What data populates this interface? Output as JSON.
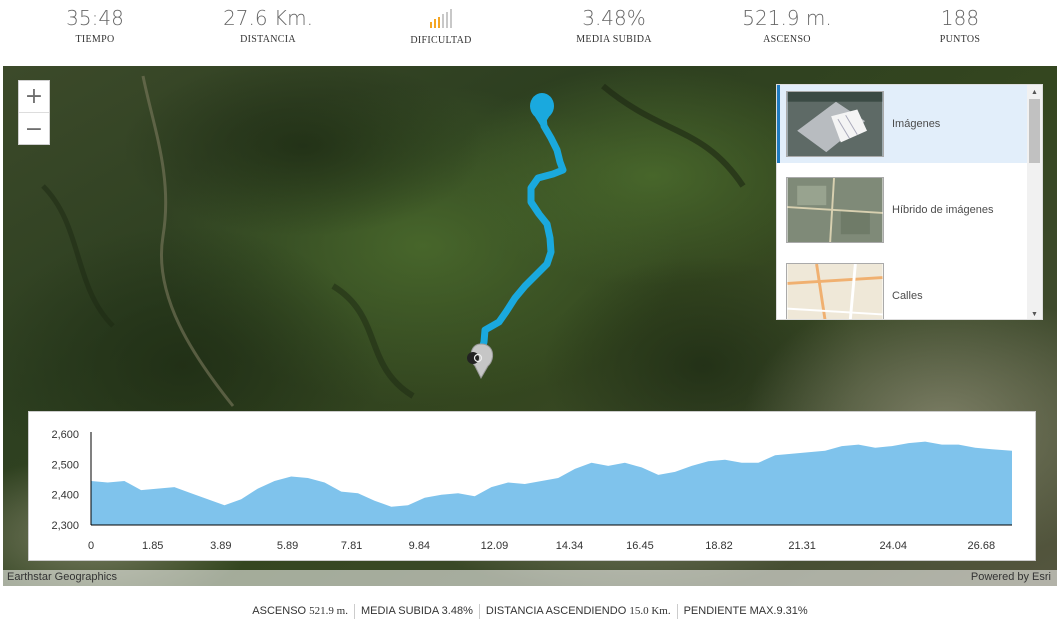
{
  "stats": [
    {
      "value": "35:48",
      "label": "TIEMPO"
    },
    {
      "value": "27.6 Km.",
      "label": "DISTANCIA"
    },
    {
      "value": "",
      "label": "DIFICULTAD",
      "bars": {
        "levels": 6,
        "active": 3,
        "active_color": "#f5a623",
        "inactive_color": "#c8c8c8"
      }
    },
    {
      "value": "3.48%",
      "label": "MEDIA SUBIDA"
    },
    {
      "value": "521.9 m.",
      "label": "ASCENSO"
    },
    {
      "value": "188",
      "label": "PUNTOS"
    }
  ],
  "map": {
    "zoom_in": "+",
    "zoom_out": "−",
    "route_color": "#1aa9de",
    "attribution_left": "Earthstar Geographics",
    "attribution_right": "Powered by Esri",
    "gallery": [
      {
        "name": "Imágenes",
        "selected": true,
        "thumb": "imagery-thumb"
      },
      {
        "name": "Híbrido de imágenes",
        "selected": false,
        "thumb": "hybrid-thumb"
      },
      {
        "name": "Calles",
        "selected": false,
        "thumb": "streets-thumb"
      }
    ]
  },
  "chart_data": {
    "type": "area",
    "title": "",
    "xlabel": "",
    "ylabel": "",
    "fill_color": "#7fc3ec",
    "x_ticks": [
      "0",
      "1.85",
      "3.89",
      "5.89",
      "7.81",
      "9.84",
      "12.09",
      "14.34",
      "16.45",
      "18.82",
      "21.31",
      "24.04",
      "26.68"
    ],
    "y_ticks": [
      "2,600",
      "2,500",
      "2,400",
      "2,300"
    ],
    "ylim": [
      2300,
      2600
    ],
    "xlim": [
      0,
      27.6
    ],
    "x": [
      0,
      0.5,
      1,
      1.5,
      2,
      2.5,
      3,
      3.5,
      4,
      4.5,
      5,
      5.5,
      6,
      6.5,
      7,
      7.5,
      8,
      8.5,
      9,
      9.5,
      10,
      10.5,
      11,
      11.5,
      12,
      12.5,
      13,
      13.5,
      14,
      14.5,
      15,
      15.5,
      16,
      16.5,
      17,
      17.5,
      18,
      18.5,
      19,
      19.5,
      20,
      20.5,
      21,
      21.5,
      22,
      22.5,
      23,
      23.5,
      24,
      24.5,
      25,
      25.5,
      26,
      26.5,
      27,
      27.6
    ],
    "values": [
      2445,
      2440,
      2445,
      2415,
      2420,
      2425,
      2405,
      2385,
      2365,
      2385,
      2420,
      2445,
      2460,
      2455,
      2440,
      2410,
      2405,
      2380,
      2360,
      2365,
      2390,
      2400,
      2405,
      2395,
      2425,
      2440,
      2435,
      2445,
      2455,
      2485,
      2505,
      2495,
      2505,
      2490,
      2465,
      2475,
      2495,
      2510,
      2515,
      2505,
      2505,
      2530,
      2535,
      2540,
      2545,
      2560,
      2565,
      2555,
      2560,
      2570,
      2575,
      2565,
      2565,
      2555,
      2550,
      2545
    ]
  },
  "footer": {
    "items": [
      {
        "label": "ASCENSO",
        "value": "521.9 m."
      },
      {
        "label": "MEDIA SUBIDA",
        "value": "3.48%"
      },
      {
        "label": "DISTANCIA ASCENDIENDO",
        "value": "15.0 Km."
      },
      {
        "label": "PENDIENTE MAX.",
        "value": "9.31%"
      }
    ]
  }
}
